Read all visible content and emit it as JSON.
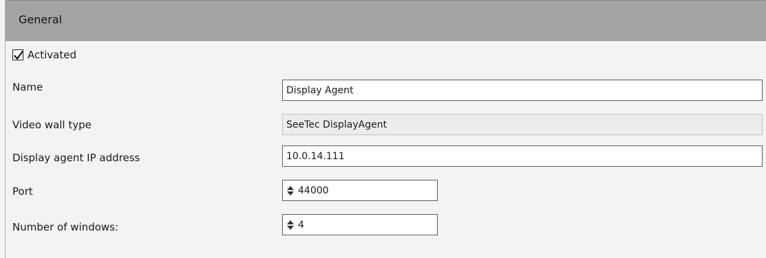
{
  "section": {
    "title": "General"
  },
  "activated": {
    "label": "Activated",
    "checked": true
  },
  "fields": {
    "name": {
      "label": "Name",
      "value": "Display Agent"
    },
    "video_wall_type": {
      "label": "Video wall type",
      "value": "SeeTec DisplayAgent"
    },
    "ip": {
      "label": "Display agent IP address",
      "value": "10.0.14.111"
    },
    "port": {
      "label": "Port",
      "value": "44000"
    },
    "windows": {
      "label": "Number of windows:",
      "value": "4"
    }
  },
  "icons": {
    "checkbox": "check-icon",
    "spinner": "up-down-spinner-icon"
  }
}
